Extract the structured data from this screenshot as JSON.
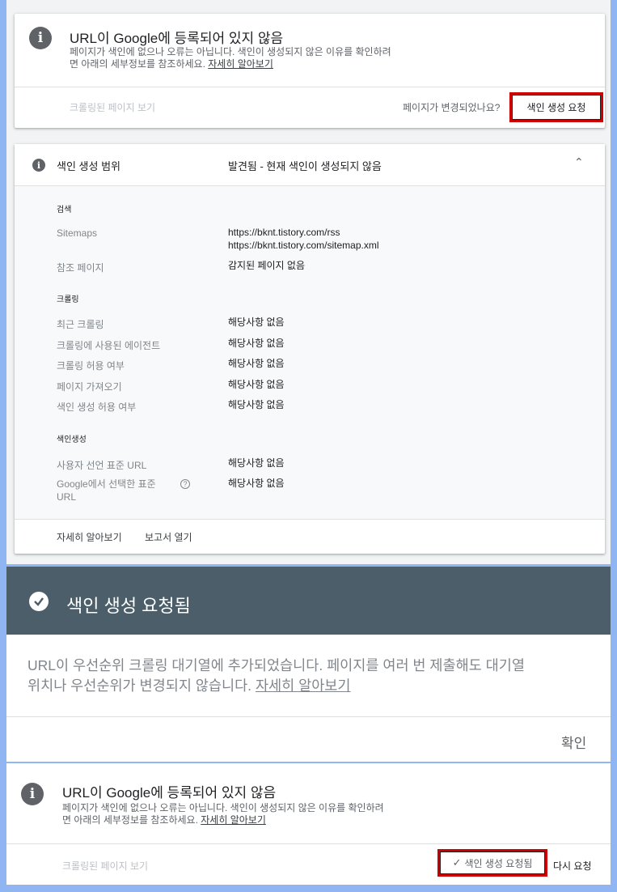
{
  "top_card": {
    "title": "URL이 Google에 등록되어 있지 않음",
    "desc_line1": "페이지가 색인에 없으나 오류는 아닙니다. 색인이 생성되지 않은 이유를 확인하려",
    "desc_line2": "면 아래의 세부정보를 참조하세요.",
    "learn_more": "자세히 알아보기",
    "view_crawled": "크롤링된 페이지 보기",
    "changed_question": "페이지가 변경되었나요?",
    "request_indexing": "색인 생성 요청"
  },
  "coverage": {
    "header_label": "색인 생성 범위",
    "header_status": "발견됨 - 현재 색인이 생성되지 않음",
    "sections": {
      "search": "검색",
      "crawl": "크롤링",
      "indexing": "색인생성"
    },
    "sitemaps_label": "Sitemaps",
    "sitemaps_value1": "https://bknt.tistory.com/rss",
    "sitemaps_value2": "https://bknt.tistory.com/sitemap.xml",
    "referring_label": "참조 페이지",
    "referring_value": "감지된 페이지 없음",
    "last_crawl_label": "최근 크롤링",
    "last_crawl_value": "해당사항 없음",
    "crawled_as_label": "크롤링에 사용된 에이전트",
    "crawled_as_value": "해당사항 없음",
    "crawl_allowed_label": "크롤링 허용 여부",
    "crawl_allowed_value": "해당사항 없음",
    "page_fetch_label": "페이지 가져오기",
    "page_fetch_value": "해당사항 없음",
    "indexing_allowed_label": "색인 생성 허용 여부",
    "indexing_allowed_value": "해당사항 없음",
    "user_canonical_label": "사용자 선언 표준 URL",
    "user_canonical_value": "해당사항 없음",
    "google_canonical_label1": "Google에서 선택한 표준",
    "google_canonical_label2": "URL",
    "google_canonical_value": "해당사항 없음",
    "learn_more": "자세히 알아보기",
    "open_report": "보고서 열기"
  },
  "dialog": {
    "title": "색인 생성 요청됨",
    "body_line1": "URL이 우선순위 크롤링 대기열에 추가되었습니다. 페이지를 여러 번 제출해도 대기열",
    "body_line2": "위치나 우선순위가 변경되지 않습니다.",
    "learn_more": "자세히 알아보기",
    "ok": "확인"
  },
  "bottom_card": {
    "title": "URL이 Google에 등록되어 있지 않음",
    "desc_line1": "페이지가 색인에 없으나 오류는 아닙니다. 색인이 생성되지 않은 이유를 확인하려",
    "desc_line2": "면 아래의 세부정보를 참조하세요.",
    "learn_more": "자세히 알아보기",
    "view_crawled": "크롤링된 페이지 보기",
    "requested": "색인 생성 요청됨",
    "request_again": "다시 요청"
  },
  "colors": {
    "background": "#8fb5f3",
    "highlight": "#cc0000",
    "dialog_header": "#4b5e69"
  }
}
